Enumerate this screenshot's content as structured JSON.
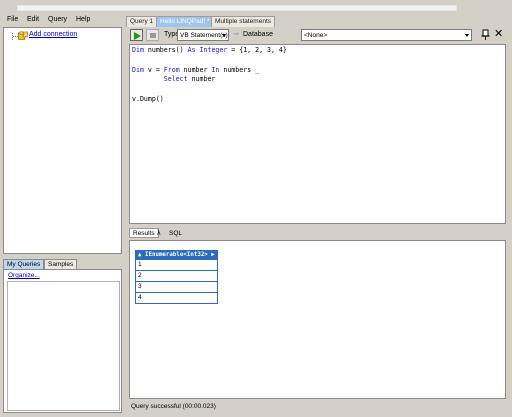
{
  "menu": [
    "File",
    "Edit",
    "Query",
    "Help"
  ],
  "connections": {
    "add_connection_label": "Add connection"
  },
  "left_tabs": [
    "My Queries",
    "Samples"
  ],
  "queries_panel": {
    "organize_label": "Organize..."
  },
  "query_tabs": [
    {
      "label": "Query 1",
      "active": false
    },
    {
      "label": "Hello LINQPad! *",
      "active": true
    },
    {
      "label": "Multiple statements",
      "active": false
    }
  ],
  "toolbar": {
    "type_label": "Type",
    "type_value": "VB Statement(s)",
    "database_label": "Database",
    "database_value": "<None>"
  },
  "editor": {
    "lines": [
      "Dim numbers() As Integer = {1, 2, 3, 4}",
      "",
      "Dim v = From number In numbers _",
      "        Select number",
      "",
      "v.Dump()"
    ]
  },
  "result_tabs": {
    "results": "Results",
    "lambda": "λ",
    "sql": "SQL"
  },
  "results": {
    "header": "▲ IEnumerable<Int32> ▶",
    "rows": [
      "1",
      "2",
      "3",
      "4"
    ]
  },
  "status": {
    "text": "Query successful  (00:00.023)"
  },
  "colors": {
    "accent": "#2a6cbd",
    "keyword": "#1b1bd8",
    "link": "#0000cc",
    "active_tab": "#9fc4ee"
  }
}
